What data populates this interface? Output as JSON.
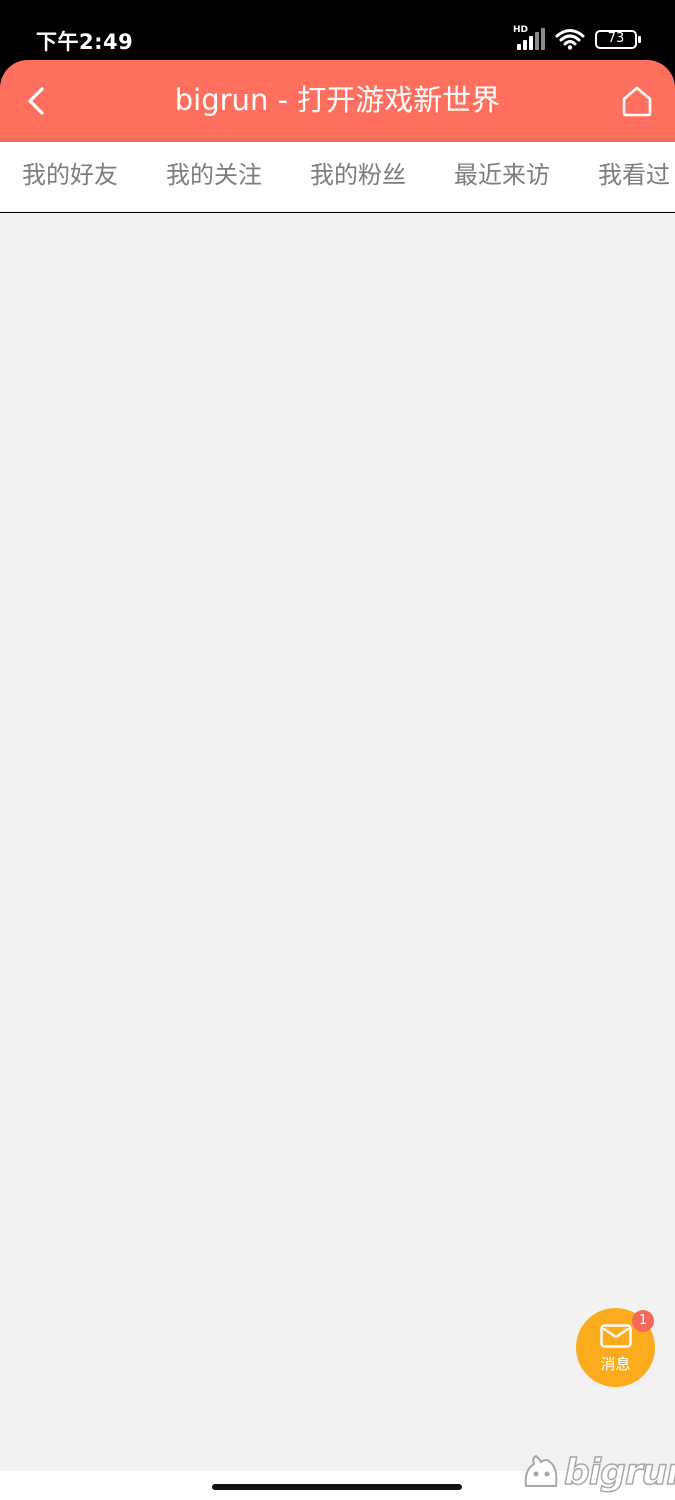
{
  "status_bar": {
    "time": "下午2:49",
    "network": "HD",
    "battery": "73"
  },
  "header": {
    "title": "bigrun - 打开游戏新世界",
    "back_icon": "chevron-left-icon",
    "home_icon": "home-icon",
    "background_color": "#ff6f5e"
  },
  "tabs": [
    {
      "label": "我的好友"
    },
    {
      "label": "我的关注"
    },
    {
      "label": "我的粉丝"
    },
    {
      "label": "最近来访"
    },
    {
      "label": "我看过"
    }
  ],
  "message_button": {
    "label": "消息",
    "badge_count": "1",
    "icon": "mail-icon",
    "color": "#fbab1c"
  },
  "watermark": {
    "text": "bigrun"
  }
}
